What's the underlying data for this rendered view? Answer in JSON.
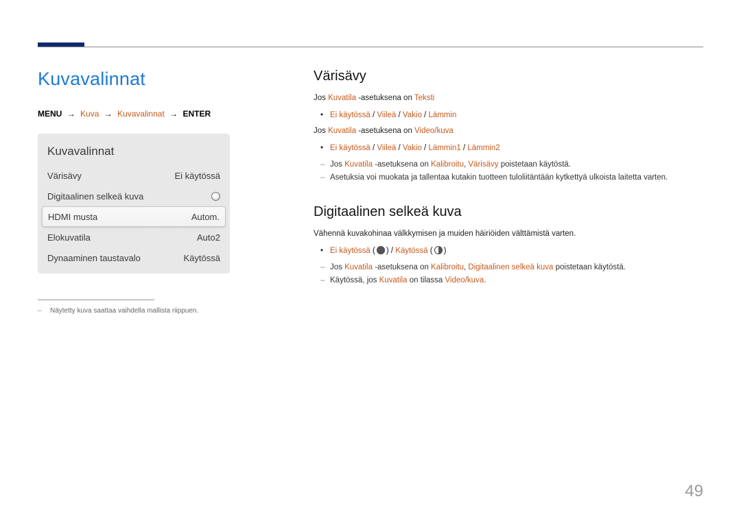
{
  "page_number": "49",
  "left": {
    "title": "Kuvavalinnat",
    "breadcrumb": {
      "menu": "MENU",
      "item1": "Kuva",
      "item2": "Kuvavalinnat",
      "enter": "ENTER"
    },
    "menu": {
      "title": "Kuvavalinnat",
      "rows": [
        {
          "label": "Värisävy",
          "value": "Ei käytössä"
        },
        {
          "label": "Digitaalinen selkeä kuva",
          "value": "",
          "icon": true
        },
        {
          "label": "HDMI musta",
          "value": "Autom."
        },
        {
          "label": "Elokuvatila",
          "value": "Auto2"
        },
        {
          "label": "Dynaaminen taustavalo",
          "value": "Käytössä"
        }
      ]
    },
    "footnote": "Näytetty kuva saattaa vaihdella mallista riippuen."
  },
  "right": {
    "sect1": {
      "heading": "Värisävy",
      "line1_pre": "Jos ",
      "line1_ac1": "Kuvatila",
      "line1_mid": " -asetuksena on ",
      "line1_ac2": "Teksti",
      "opts1": {
        "a": "Ei käytössä",
        "b": "Viileä",
        "c": "Vakio",
        "d": "Lämmin"
      },
      "line2_pre": "Jos ",
      "line2_ac1": "Kuvatila",
      "line2_mid": " -asetuksena on ",
      "line2_ac2": "Video/kuva",
      "opts2": {
        "a": "Ei käytössä",
        "b": "Viileä",
        "c": "Vakio",
        "d": "Lämmin1",
        "e": "Lämmin2"
      },
      "dash1_pre": "Jos ",
      "dash1_ac1": "Kuvatila",
      "dash1_mid": " -asetuksena on ",
      "dash1_ac2": "Kalibroitu",
      "dash1_mid2": ", ",
      "dash1_ac3": "Värisävy",
      "dash1_end": " poistetaan käytöstä.",
      "dash2": "Asetuksia voi muokata ja tallentaa kutakin tuotteen tuloliitäntään kytkettyä ulkoista laitetta varten."
    },
    "sect2": {
      "heading": "Digitaalinen selkeä kuva",
      "intro": "Vähennä kuvakohinaa välkkymisen ja muiden häiriöiden välttämistä varten.",
      "opt_off": "Ei käytössä",
      "opt_on": "Käytössä",
      "paren_open": " (",
      "paren_close": ")",
      "dash1_pre": "Jos ",
      "dash1_ac1": "Kuvatila",
      "dash1_mid": " -asetuksena on ",
      "dash1_ac2": "Kalibroitu",
      "dash1_mid2": ", ",
      "dash1_ac3": "Digitaalinen selkeä kuva",
      "dash1_end": " poistetaan käytöstä.",
      "dash2_pre": "Käytössä, jos ",
      "dash2_ac1": "Kuvatila",
      "dash2_mid": " on tilassa ",
      "dash2_ac2": "Video/kuva",
      "dash2_end": "."
    }
  }
}
